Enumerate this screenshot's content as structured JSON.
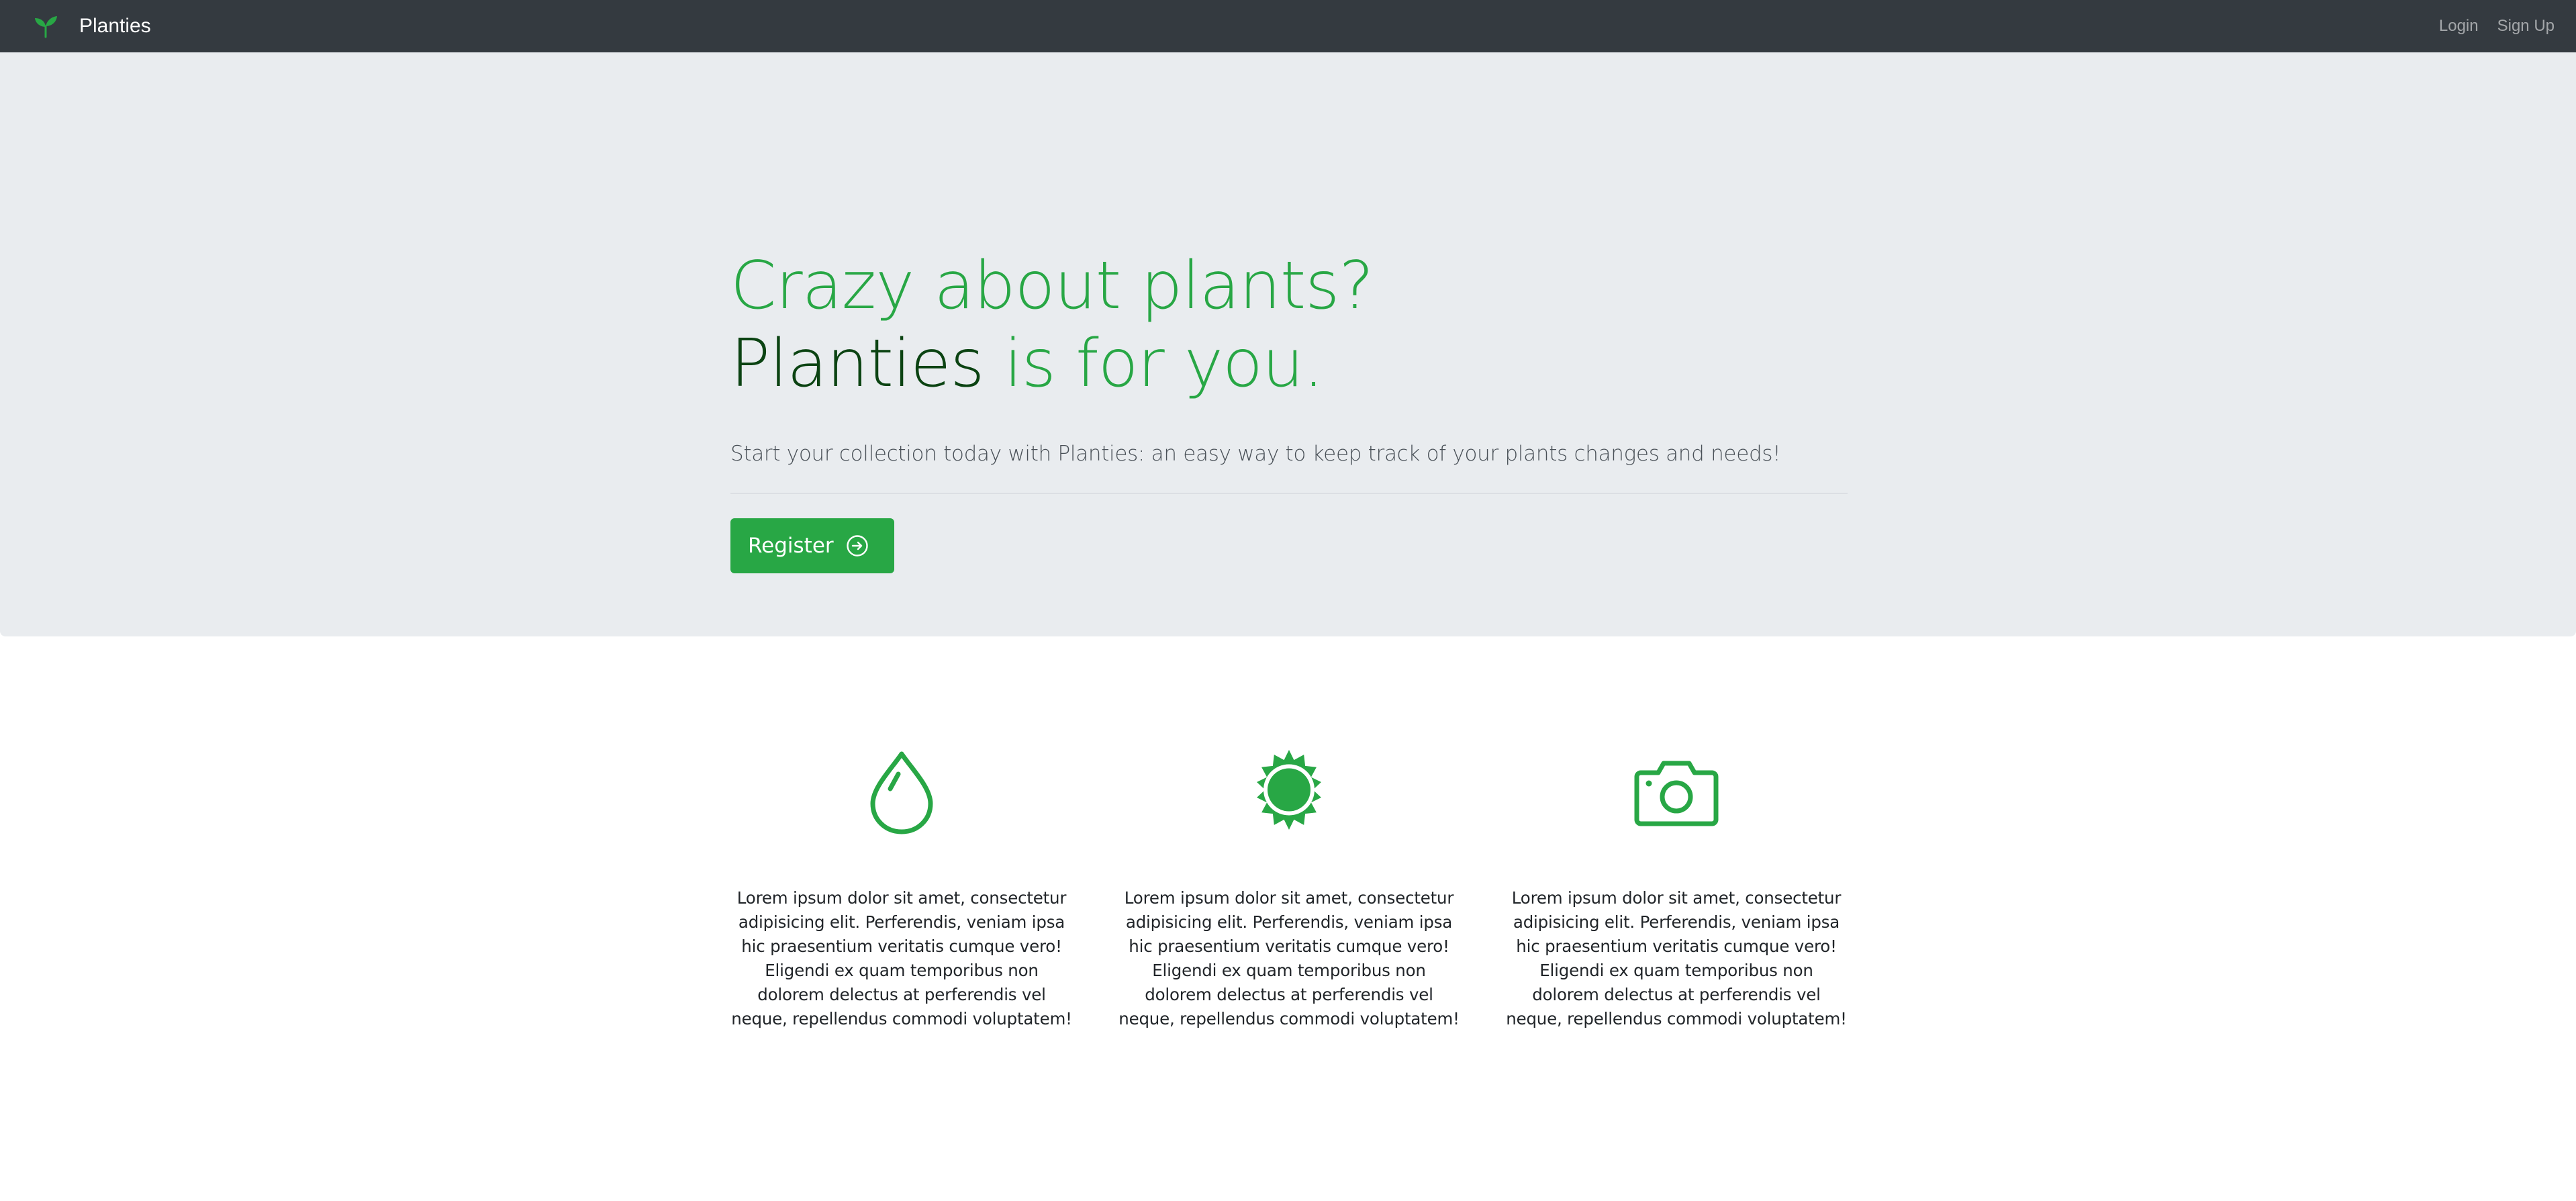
{
  "navbar": {
    "brand": "Planties",
    "brand_icon": "sprout-icon",
    "links": [
      "Login",
      "Sign Up"
    ]
  },
  "hero": {
    "title_line1": "Crazy about plants?",
    "title_line2_dark": "Planties",
    "title_line2_rest": " is for you.",
    "lead": "Start your collection today with Planties: an easy way to keep track of your plants changes and needs!",
    "button_label": "Register",
    "button_icon": "arrow-right-circle-icon"
  },
  "features": [
    {
      "icon": "droplet-icon",
      "text": "Lorem ipsum dolor sit amet, consectetur adipisicing elit. Perferendis, veniam ipsa hic praesentium veritatis cumque vero! Eligendi ex quam temporibus non dolorem delectus at perferendis vel neque, repellendus commodi voluptatem!"
    },
    {
      "icon": "sun-icon",
      "text": "Lorem ipsum dolor sit amet, consectetur adipisicing elit. Perferendis, veniam ipsa hic praesentium veritatis cumque vero! Eligendi ex quam temporibus non dolorem delectus at perferendis vel neque, repellendus commodi voluptatem!"
    },
    {
      "icon": "camera-icon",
      "text": "Lorem ipsum dolor sit amet, consectetur adipisicing elit. Perferendis, veniam ipsa hic praesentium veritatis cumque vero! Eligendi ex quam temporibus non dolorem delectus at perferendis vel neque, repellendus commodi voluptatem!"
    }
  ],
  "colors": {
    "navbar_bg": "#343a40",
    "hero_bg": "#e9ecef",
    "accent_green": "#28a745",
    "dark_green": "#0b4312"
  }
}
